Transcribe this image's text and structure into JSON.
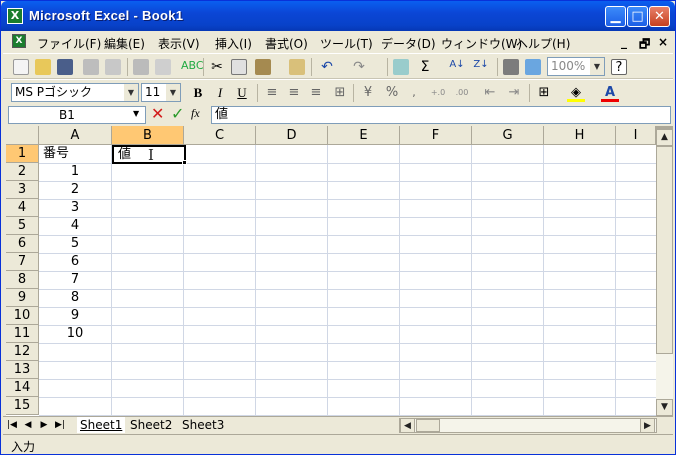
{
  "window": {
    "title": "Microsoft Excel - Book1",
    "app_icon": "excel-icon"
  },
  "menu": {
    "items": [
      "ファイル(F)",
      "編集(E)",
      "表示(V)",
      "挿入(I)",
      "書式(O)",
      "ツール(T)",
      "データ(D)",
      "ウィンドウ(W)",
      "ヘルプ(H)"
    ],
    "mdi_min": "_",
    "mdi_restore": "🗗",
    "mdi_close": "×"
  },
  "format": {
    "font_name": "MS Pゴシック",
    "font_size": "11",
    "zoom": "100%"
  },
  "formula": {
    "name_box": "B1",
    "cancel": "✕",
    "enter": "✓",
    "fx": "fx",
    "content": "値"
  },
  "grid": {
    "columns": [
      "A",
      "B",
      "C",
      "D",
      "E",
      "F",
      "G",
      "H",
      "I"
    ],
    "rows": [
      "1",
      "2",
      "3",
      "4",
      "5",
      "6",
      "7",
      "8",
      "9",
      "10",
      "11",
      "12",
      "13",
      "14",
      "15"
    ],
    "cells": {
      "A1": "番号",
      "B1": "値",
      "A2": "1",
      "A3": "2",
      "A4": "3",
      "A5": "4",
      "A6": "5",
      "A7": "6",
      "A8": "7",
      "A9": "8",
      "A10": "9",
      "A11": "10"
    },
    "active_cell": "B1"
  },
  "sheets": [
    "Sheet1",
    "Sheet2",
    "Sheet3"
  ],
  "status": {
    "mode": "入力"
  }
}
